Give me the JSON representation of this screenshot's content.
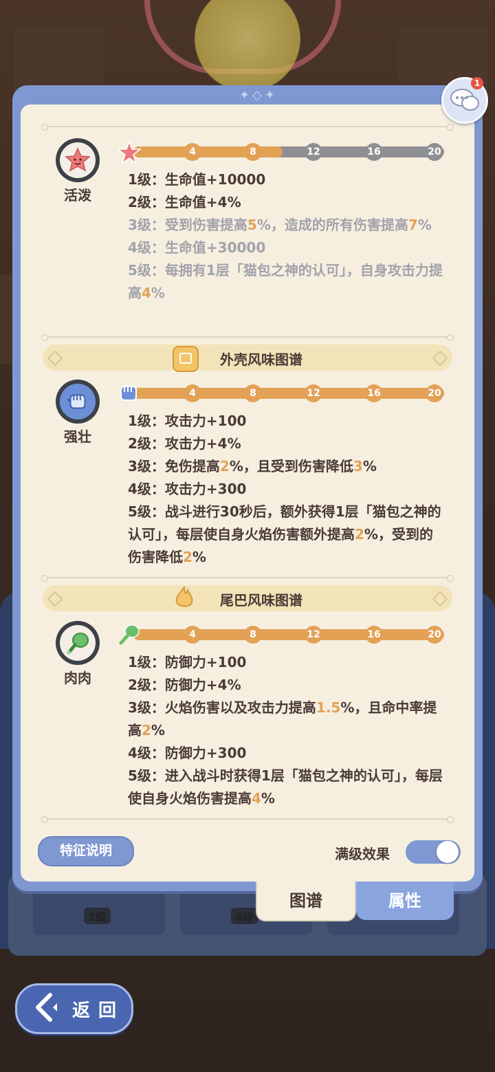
{
  "chat": {
    "badge_count": "1"
  },
  "traits": [
    {
      "name": "活泼",
      "icon": "star-face-icon",
      "progress": {
        "level_fraction": 0.48,
        "ticks": [
          "4",
          "8",
          "12",
          "16",
          "20"
        ],
        "ticks_reached": 2
      },
      "lines": [
        {
          "active": true,
          "parts": [
            {
              "t": "1级：生命值+10000"
            }
          ]
        },
        {
          "active": true,
          "parts": [
            {
              "t": "2级：生命值+4%"
            }
          ]
        },
        {
          "active": false,
          "parts": [
            {
              "t": "3级：受到伤害提高"
            },
            {
              "t": "5",
              "hl": true
            },
            {
              "t": "%，造成的所有伤害提高"
            },
            {
              "t": "7",
              "hl": true
            },
            {
              "t": "%"
            }
          ]
        },
        {
          "active": false,
          "parts": [
            {
              "t": "4级：生命值+30000"
            }
          ]
        },
        {
          "active": false,
          "parts": [
            {
              "t": "5级：每拥有1层「猫包之神的认可」，自身攻击力提高"
            },
            {
              "t": "4",
              "hl": true
            },
            {
              "t": "%"
            }
          ]
        }
      ]
    },
    {
      "name": "强壮",
      "icon": "fist-icon",
      "section_title": "外壳风味图谱",
      "section_icon": "shell-icon",
      "progress": {
        "level_fraction": 1.0,
        "ticks": [
          "4",
          "8",
          "12",
          "16",
          "20"
        ],
        "ticks_reached": 5
      },
      "lines": [
        {
          "active": true,
          "parts": [
            {
              "t": "1级：攻击力+100"
            }
          ]
        },
        {
          "active": true,
          "parts": [
            {
              "t": "2级：攻击力+4%"
            }
          ]
        },
        {
          "active": true,
          "parts": [
            {
              "t": "3级：免伤提高"
            },
            {
              "t": "2",
              "hl": true
            },
            {
              "t": "%，且受到伤害降低"
            },
            {
              "t": "3",
              "hl": true
            },
            {
              "t": "%"
            }
          ]
        },
        {
          "active": true,
          "parts": [
            {
              "t": "4级：攻击力+300"
            }
          ]
        },
        {
          "active": true,
          "parts": [
            {
              "t": "5级：战斗进行30秒后，额外获得1层「猫包之神的认可」，每层使自身火焰伤害额外提高"
            },
            {
              "t": "2",
              "hl": true
            },
            {
              "t": "%，受到的伤害降低"
            },
            {
              "t": "2",
              "hl": true
            },
            {
              "t": "%"
            }
          ]
        }
      ]
    },
    {
      "name": "肉肉",
      "icon": "drumstick-icon",
      "section_title": "尾巴风味图谱",
      "section_icon": "flame-tail-icon",
      "progress": {
        "level_fraction": 1.0,
        "ticks": [
          "4",
          "8",
          "12",
          "16",
          "20"
        ],
        "ticks_reached": 5
      },
      "lines": [
        {
          "active": true,
          "parts": [
            {
              "t": "1级：防御力+100"
            }
          ]
        },
        {
          "active": true,
          "parts": [
            {
              "t": "2级：防御力+4%"
            }
          ]
        },
        {
          "active": true,
          "parts": [
            {
              "t": "3级：火焰伤害以及攻击力提高"
            },
            {
              "t": "1.5",
              "hl": true
            },
            {
              "t": "%，且命中率提高"
            },
            {
              "t": "2",
              "hl": true
            },
            {
              "t": "%"
            }
          ]
        },
        {
          "active": true,
          "parts": [
            {
              "t": "4级：防御力+300"
            }
          ]
        },
        {
          "active": true,
          "parts": [
            {
              "t": "5级：进入战斗时获得1层「猫包之神的认可」，每层使自身火焰伤害提高"
            },
            {
              "t": "4",
              "hl": true
            },
            {
              "t": "%"
            }
          ]
        }
      ]
    }
  ],
  "footer": {
    "feature_button": "特征说明",
    "max_level_label": "满级效果",
    "max_level_on": true
  },
  "tabs": [
    {
      "label": "图谱",
      "selected": false
    },
    {
      "label": "属性",
      "selected": true
    }
  ],
  "background_slots": [
    "1级",
    "4级"
  ],
  "back_button": "返回",
  "colors": {
    "accent_orange": "#e3a156",
    "panel_blue": "#7f98d2",
    "inactive_text": "#a2a2aa",
    "panel_cream": "#f6efe0"
  }
}
